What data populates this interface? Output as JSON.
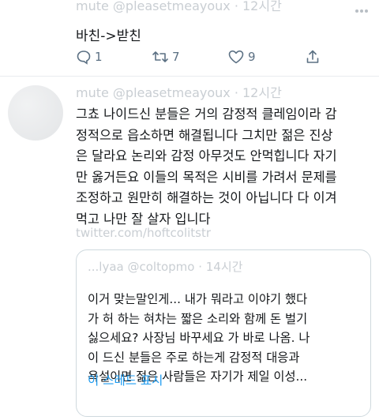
{
  "tweet1": {
    "header": "mute @pleasetmeayoux · 12시간",
    "text": "바친->받친",
    "replies": "1",
    "retweets": "7",
    "likes": "9"
  },
  "tweet2": {
    "header": "mute @pleasetmeayoux · 12시간",
    "lines": [
      "그쵸 나이드신 분들은 거의 감정적 클레임이라 감",
      "정적으로 읍소하면 해결됩니다 그치만 젊은 진상",
      "은 달라요 논리와 감정 아무것도 안먹힙니다 자기",
      "만 옳거든요 이들의 목적은 시비를 가려서 문제를",
      "조정하고 원만히 해결하는 것이 아닙니다 다 이겨",
      "먹고 나만 잘 살자 입니다"
    ],
    "link": "twitter.com/hoftcolitstr"
  },
  "quote": {
    "header": "...lyaa @coltopmo · 14시간",
    "lines": [
      "이거 맞는말인게... 내가 뭐라고 이야기 했다",
      "가 허 하는 혀차는 짧은 소리와 함께 돈 벌기",
      "싫으세요? 사장님 바꾸세요 가 바로 나옴. 나",
      "이 드신 분들은 주로 하는게 감정적 대응과",
      "욕설이면 젊은 사람들은 자기가 제일 이성..."
    ],
    "show_thread": "이 스레드 표시"
  },
  "icons": [
    "reply-icon",
    "retweet-icon",
    "like-icon",
    "share-icon",
    "more-icon"
  ],
  "colors": {
    "link": "#1d9bf0",
    "muted": "#5b7083",
    "faded": "#c9ced3"
  }
}
